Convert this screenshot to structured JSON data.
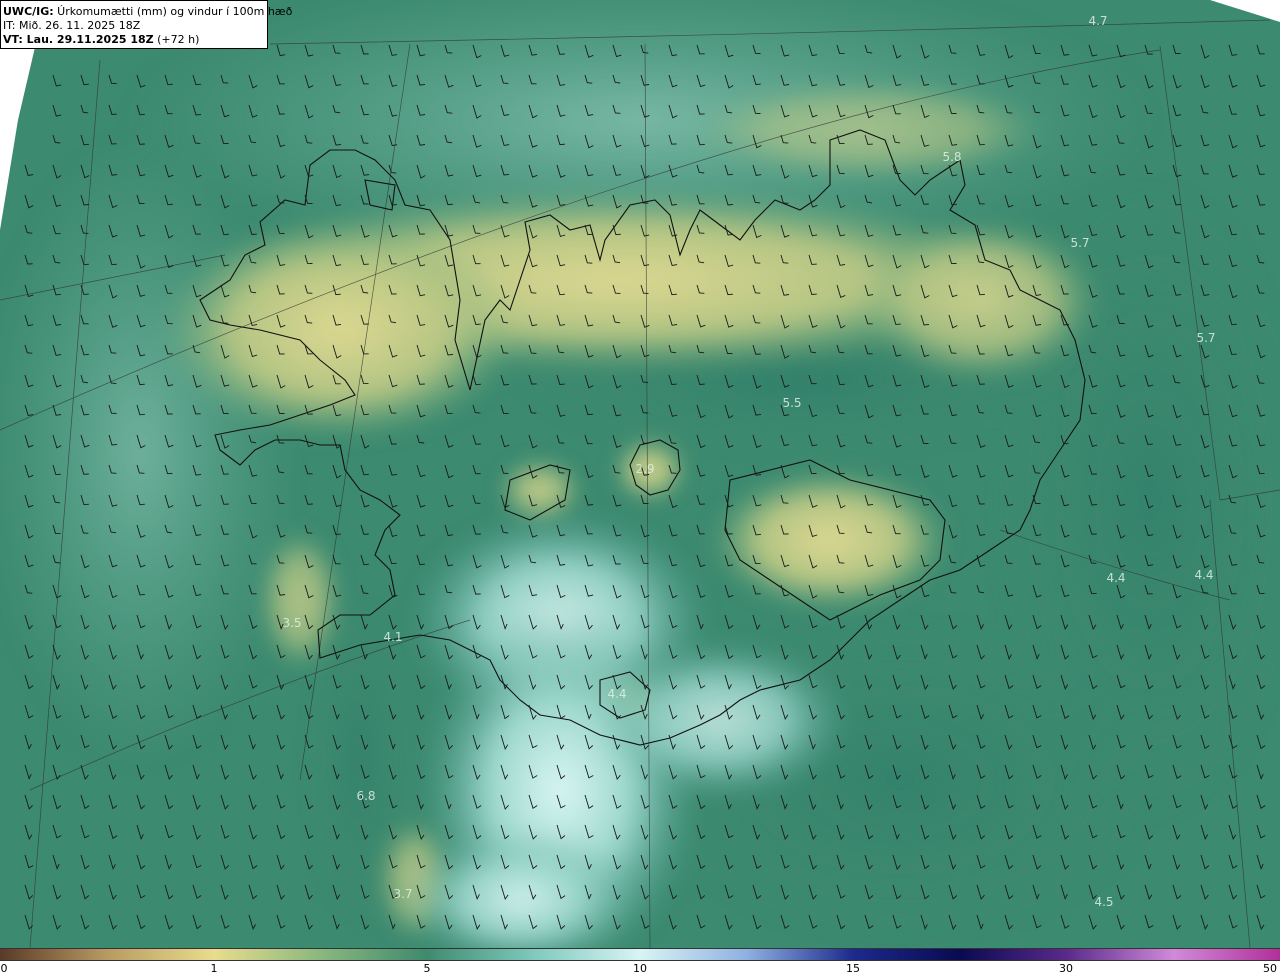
{
  "header": {
    "model": "UWC/IG:",
    "description": " Úrkomumætti (mm) og vindur í 100m hæð",
    "init_time": "IT: Mið. 26. 11. 2025 18Z",
    "valid_prefix": "VT: Lau. 29.11.2025 18Z",
    "valid_suffix": " (+72 h)"
  },
  "map_values": [
    {
      "id": "v1",
      "text": "4.7"
    },
    {
      "id": "v2",
      "text": "5.8"
    },
    {
      "id": "v3",
      "text": "5.7"
    },
    {
      "id": "v4",
      "text": "5.7"
    },
    {
      "id": "v5",
      "text": "5.5"
    },
    {
      "id": "v6",
      "text": "2.9"
    },
    {
      "id": "v7",
      "text": "3.5"
    },
    {
      "id": "v8",
      "text": "4.1"
    },
    {
      "id": "v9",
      "text": "4.4"
    },
    {
      "id": "v10",
      "text": "4.4"
    },
    {
      "id": "v11",
      "text": "4.4"
    },
    {
      "id": "v12",
      "text": "6.8"
    },
    {
      "id": "v13",
      "text": "3.7"
    },
    {
      "id": "v14",
      "text": "4.5"
    }
  ],
  "colorbar": {
    "ticks": [
      "0",
      "1",
      "5",
      "10",
      "15",
      "30",
      "50"
    ],
    "colors": [
      "#5a3a28",
      "#b79a62",
      "#e9dc8e",
      "#8ab87e",
      "#3f8a6e",
      "#7fc9bd",
      "#d8f4f4",
      "#8fb1e0",
      "#1c2a8c",
      "#0a0a50",
      "#5a2a8a",
      "#d08ad8",
      "#b0309a"
    ]
  }
}
